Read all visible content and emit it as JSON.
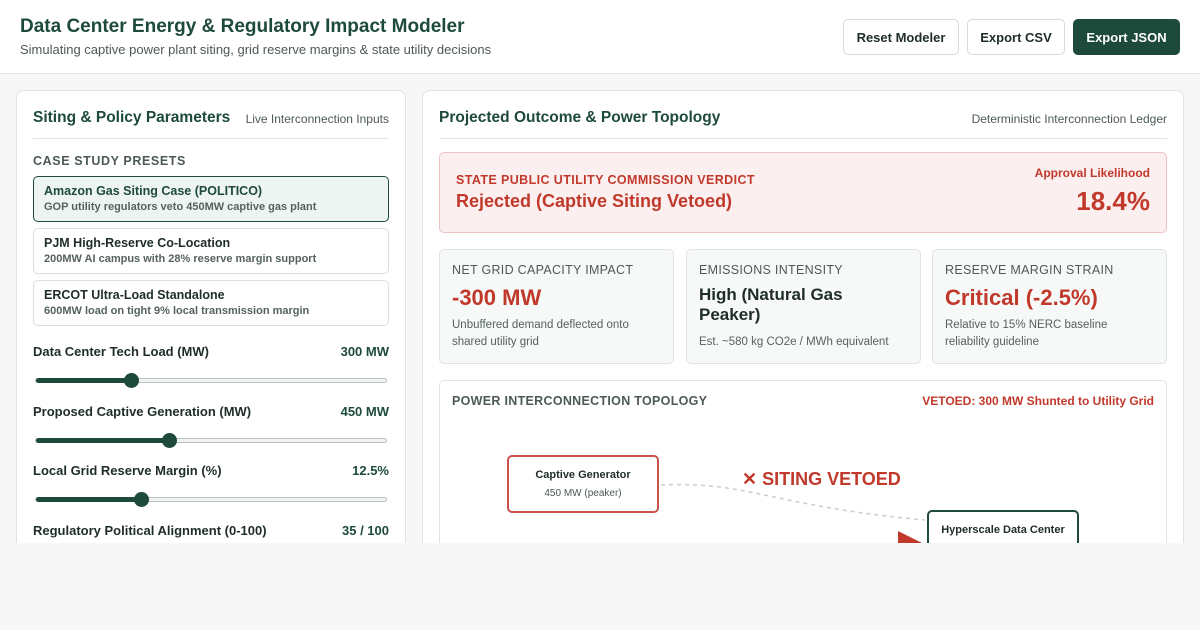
{
  "header": {
    "title": "Data Center Energy & Regulatory Impact Modeler",
    "subtitle": "Simulating captive power plant siting, grid reserve margins & state utility decisions",
    "buttons": {
      "reset": "Reset Modeler",
      "csv": "Export CSV",
      "json": "Export JSON"
    }
  },
  "left_panel": {
    "title": "Siting & Policy Parameters",
    "tag": "Live Interconnection Inputs",
    "presets_label": "CASE STUDY PRESETS",
    "presets": [
      {
        "title": "Amazon Gas Siting Case (POLITICO)",
        "desc": "GOP utility regulators veto 450MW captive gas plant",
        "active": true
      },
      {
        "title": "PJM High-Reserve Co-Location",
        "desc": "200MW AI campus with 28% reserve margin support",
        "active": false
      },
      {
        "title": "ERCOT Ultra-Load Standalone",
        "desc": "600MW load on tight 9% local transmission margin",
        "active": false
      }
    ],
    "sliders": [
      {
        "label": "Data Center Tech Load (MW)",
        "value": "300 MW",
        "fraction": 0.27
      },
      {
        "label": "Proposed Captive Generation (MW)",
        "value": "450 MW",
        "fraction": 0.38
      },
      {
        "label": "Local Grid Reserve Margin (%)",
        "value": "12.5%",
        "fraction": 0.3
      },
      {
        "label": "Regulatory Political Alignment (0-100)",
        "value": "35 / 100",
        "fraction": 0.35
      }
    ]
  },
  "right_panel": {
    "title": "Projected Outcome & Power Topology",
    "tag": "Deterministic Interconnection Ledger",
    "verdict": {
      "label": "STATE PUBLIC UTILITY COMMISSION VERDICT",
      "value": "Rejected (Captive Siting Vetoed)",
      "likelihood_label": "Approval Likelihood",
      "likelihood_value": "18.4%"
    },
    "metrics": [
      {
        "label": "NET GRID CAPACITY IMPACT",
        "value": "-300 MW",
        "note": "Unbuffered demand deflected onto shared utility grid"
      },
      {
        "label": "EMISSIONS INTENSITY",
        "value": "High (Natural Gas Peaker)",
        "note": "Est. ~580 kg CO2e / MWh equivalent"
      },
      {
        "label": "RESERVE MARGIN STRAIN",
        "value": "Critical (-2.5%)",
        "note": "Relative to 15% NERC baseline reliability guideline"
      }
    ],
    "topology": {
      "title": "POWER INTERCONNECTION TOPOLOGY",
      "status": "VETOED: 300 MW Shunted to Utility Grid",
      "veto_label": "✕ SITING VETOED",
      "generator": {
        "name": "Captive Generator",
        "sub": "450 MW (peaker)"
      },
      "datacenter": {
        "name": "Hyperscale Data Center"
      }
    }
  },
  "colors": {
    "brand": "#1d4a3a",
    "alert": "#c0392b",
    "alert_bg": "#fcefef"
  }
}
